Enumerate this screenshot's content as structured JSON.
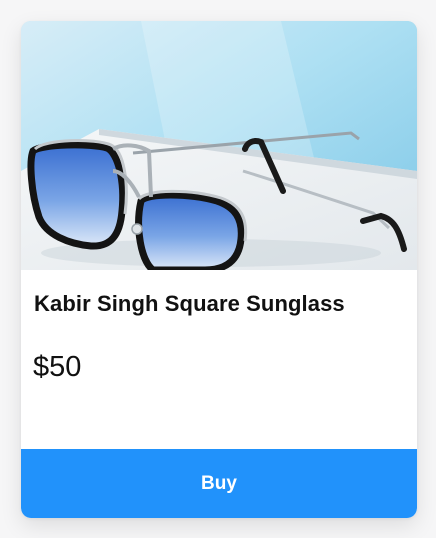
{
  "product": {
    "image_name": "sunglasses-product-image",
    "title": "Kabir Singh Square Sunglass",
    "price": "$50",
    "buy_label": "Buy"
  },
  "colors": {
    "button": "#2192fb",
    "background_blue": "#9fd4ec",
    "text": "#111111"
  }
}
